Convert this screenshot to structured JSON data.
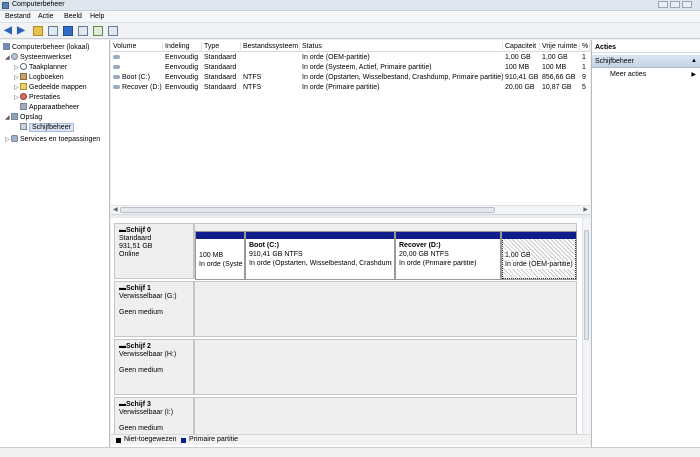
{
  "window": {
    "title": "Computerbeheer"
  },
  "menu": [
    "Bestand",
    "Actie",
    "Beeld",
    "Help"
  ],
  "toolbar": {
    "icons": [
      "back-arrow-icon",
      "forward-arrow-icon",
      "up-folder-icon",
      "show-hide-tree-icon",
      "help-icon",
      "properties-icon",
      "refresh-icon",
      "export-icon"
    ]
  },
  "tree": {
    "root": "Computerbeheer (lokaal)",
    "system_tools": "Systeemwerkset",
    "task_scheduler": "Taakplanner",
    "event_viewer": "Logboeken",
    "shared_folders": "Gedeelde mappen",
    "performance": "Prestaties",
    "device_manager": "Apparaatbeheer",
    "storage": "Opslag",
    "disk_management": "Schijfbeheer",
    "services": "Services en toepassingen"
  },
  "volume_table": {
    "columns": [
      "Volume",
      "Indeling",
      "Type",
      "Bestandssysteem",
      "Status",
      "Capaciteit",
      "Vrije ruimte",
      "%"
    ],
    "rows": [
      [
        "",
        "Eenvoudig",
        "Standaard",
        "",
        "In orde (OEM-partitie)",
        "1,00 GB",
        "1,00 GB",
        "1"
      ],
      [
        "",
        "Eenvoudig",
        "Standaard",
        "",
        "In orde (Systeem, Actief, Primaire partitie)",
        "100 MB",
        "100 MB",
        "1"
      ],
      [
        "Boot (C:)",
        "Eenvoudig",
        "Standaard",
        "NTFS",
        "In orde (Opstarten, Wisselbestand, Crashdump, Primaire partitie)",
        "910,41 GB",
        "856,66 GB",
        "9"
      ],
      [
        "Recover (D:)",
        "Eenvoudig",
        "Standaard",
        "NTFS",
        "In orde (Primaire partitie)",
        "20,00 GB",
        "10,87 GB",
        "5"
      ]
    ]
  },
  "disks": [
    {
      "name": "Schijf 0",
      "line1": "Standaard",
      "line2": "931,51 GB",
      "line3": "Online"
    },
    {
      "name": "Schijf 1",
      "line1": "Verwisselbaar (G:)",
      "line2": "",
      "line3": "Geen medium"
    },
    {
      "name": "Schijf 2",
      "line1": "Verwisselbaar (H:)",
      "line2": "",
      "line3": "Geen medium"
    },
    {
      "name": "Schijf 3",
      "line1": "Verwisselbaar (I:)",
      "line2": "",
      "line3": "Geen medium"
    }
  ],
  "partitions": [
    {
      "title": "",
      "size": "100 MB",
      "status": "In orde (Syste"
    },
    {
      "title": "Boot  (C:)",
      "size": "910,41 GB NTFS",
      "status": "In orde (Opstarten, Wisselbestand, Crashdump"
    },
    {
      "title": "Recover  (D:)",
      "size": "20,00 GB NTFS",
      "status": "In orde (Primaire partitie)"
    },
    {
      "title": "",
      "size": "1,00 GB",
      "status": "In orde (OEM-partitie)"
    }
  ],
  "legend": [
    {
      "label": "Niet-toegewezen",
      "color": "#000000"
    },
    {
      "label": "Primaire partitie",
      "color": "#0f1e8c"
    }
  ],
  "actions": {
    "header": "Acties",
    "section": "Schijfbeheer",
    "more": "Meer acties"
  }
}
